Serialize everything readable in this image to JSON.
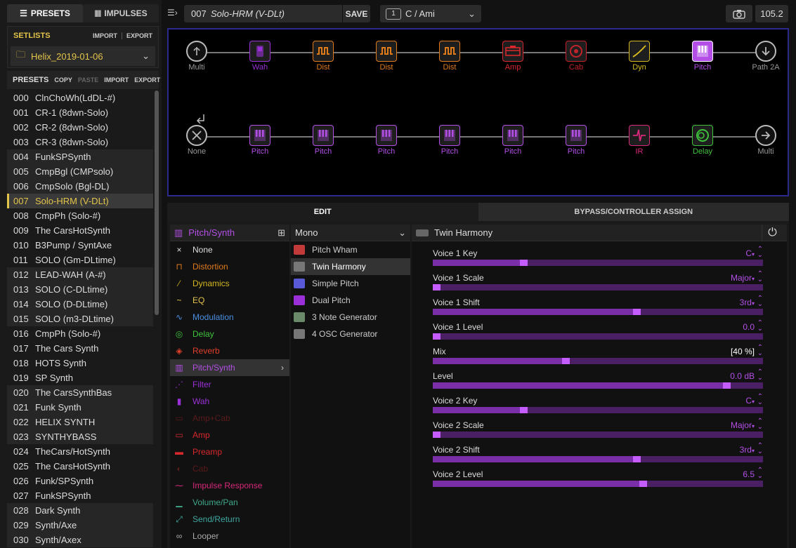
{
  "tabs": {
    "presets": "PRESETS",
    "impulses": "IMPULSES"
  },
  "setlists": {
    "title": "SETLISTS",
    "import": "IMPORT",
    "export": "EXPORT",
    "selected": "Helix_2019-01-06"
  },
  "presets_header": {
    "title": "PRESETS",
    "copy": "COPY",
    "paste": "PASTE",
    "import": "IMPORT",
    "export": "EXPORT"
  },
  "presets": [
    {
      "num": "000",
      "name": "ClnChoWh(LdDL-#)"
    },
    {
      "num": "001",
      "name": "CR-1 (8dwn-Solo)"
    },
    {
      "num": "002",
      "name": "CR-2 (8dwn-Solo)"
    },
    {
      "num": "003",
      "name": "CR-3 (8dwn-Solo)"
    },
    {
      "num": "004",
      "name": "FunkSPSynth"
    },
    {
      "num": "005",
      "name": "CmpBgl (CMPsolo)"
    },
    {
      "num": "006",
      "name": "CmpSolo (Bgl-DL)"
    },
    {
      "num": "007",
      "name": "Solo-HRM (V-DLt)"
    },
    {
      "num": "008",
      "name": "CmpPh (Solo-#)"
    },
    {
      "num": "009",
      "name": "The CarsHotSynth"
    },
    {
      "num": "010",
      "name": "B3Pump / SyntAxe"
    },
    {
      "num": "011",
      "name": "SOLO (Gm-DLtime)"
    },
    {
      "num": "012",
      "name": "LEAD-WAH (A-#)"
    },
    {
      "num": "013",
      "name": "SOLO (C-DLtime)"
    },
    {
      "num": "014",
      "name": "SOLO (D-DLtime)"
    },
    {
      "num": "015",
      "name": "SOLO (m3-DLtime)"
    },
    {
      "num": "016",
      "name": "CmpPh (Solo-#)"
    },
    {
      "num": "017",
      "name": "The Cars Synth"
    },
    {
      "num": "018",
      "name": "HOTS Synth"
    },
    {
      "num": "019",
      "name": "SP Synth"
    },
    {
      "num": "020",
      "name": "The CarsSynthBas"
    },
    {
      "num": "021",
      "name": "Funk Synth"
    },
    {
      "num": "022",
      "name": "HELIX SYNTH"
    },
    {
      "num": "023",
      "name": "SYNTHYBASS"
    },
    {
      "num": "024",
      "name": "TheCars/HotSynth"
    },
    {
      "num": "025",
      "name": "The CarsHotSynth"
    },
    {
      "num": "026",
      "name": "Funk/SPSynth"
    },
    {
      "num": "027",
      "name": "FunkSPSynth"
    },
    {
      "num": "028",
      "name": "Dark Synth"
    },
    {
      "num": "029",
      "name": "Synth/Axe"
    },
    {
      "num": "030",
      "name": "Synth/Axex"
    }
  ],
  "current_preset": {
    "num": "007",
    "name": "Solo-HRM (V-DLt)",
    "save": "SAVE"
  },
  "snapshot": {
    "badge": "1",
    "label": "C / Ami"
  },
  "tempo": "105.2",
  "flow_row1": [
    {
      "label": "Multi",
      "color": "#999999"
    },
    {
      "label": "Wah",
      "color": "#9b30d9"
    },
    {
      "label": "Dist",
      "color": "#e07b1a"
    },
    {
      "label": "Dist",
      "color": "#e07b1a"
    },
    {
      "label": "Dist",
      "color": "#e07b1a"
    },
    {
      "label": "Amp",
      "color": "#d8282d"
    },
    {
      "label": "Cab",
      "color": "#c2232a"
    },
    {
      "label": "Dyn",
      "color": "#d4b81e"
    },
    {
      "label": "Pitch",
      "color": "#b34fe6"
    },
    {
      "label": "Path 2A",
      "color": "#999999"
    }
  ],
  "flow_row2": [
    {
      "label": "None",
      "color": "#999999"
    },
    {
      "label": "Pitch",
      "color": "#b34fe6"
    },
    {
      "label": "Pitch",
      "color": "#b34fe6"
    },
    {
      "label": "Pitch",
      "color": "#b34fe6"
    },
    {
      "label": "Pitch",
      "color": "#b34fe6"
    },
    {
      "label": "Pitch",
      "color": "#b34fe6"
    },
    {
      "label": "Pitch",
      "color": "#b34fe6"
    },
    {
      "label": "IR",
      "color": "#d8287a"
    },
    {
      "label": "Delay",
      "color": "#3fc23b"
    },
    {
      "label": "Multi",
      "color": "#999999"
    }
  ],
  "edit_tabs": {
    "edit": "EDIT",
    "bypass": "BYPASS/CONTROLLER ASSIGN"
  },
  "category_header": "Pitch/Synth",
  "categories": [
    {
      "label": "None",
      "color": "#dddddd",
      "icon": "×"
    },
    {
      "label": "Distortion",
      "color": "#e07b1a",
      "icon": "⊓"
    },
    {
      "label": "Dynamics",
      "color": "#d4b81e",
      "icon": "⁄"
    },
    {
      "label": "EQ",
      "color": "#e3c44a",
      "icon": "~"
    },
    {
      "label": "Modulation",
      "color": "#4a8fe0",
      "icon": "∿"
    },
    {
      "label": "Delay",
      "color": "#3fc23b",
      "icon": "◎"
    },
    {
      "label": "Reverb",
      "color": "#e0402a",
      "icon": "◈"
    },
    {
      "label": "Pitch/Synth",
      "color": "#b34fe6",
      "icon": "▥"
    },
    {
      "label": "Filter",
      "color": "#9b30d9",
      "icon": "⋰"
    },
    {
      "label": "Wah",
      "color": "#9b30d9",
      "icon": "▮"
    },
    {
      "label": "Amp+Cab",
      "color": "#5a1a1a",
      "icon": "▭"
    },
    {
      "label": "Amp",
      "color": "#d8282d",
      "icon": "▭"
    },
    {
      "label": "Preamp",
      "color": "#d8282d",
      "icon": "▬"
    },
    {
      "label": "Cab",
      "color": "#5a1a1a",
      "icon": "◐"
    },
    {
      "label": "Impulse Response",
      "color": "#d8287a",
      "icon": "⁓"
    },
    {
      "label": "Volume/Pan",
      "color": "#3fa88a",
      "icon": "▁"
    },
    {
      "label": "Send/Return",
      "color": "#3fa8a0",
      "icon": "⤢"
    },
    {
      "label": "Looper",
      "color": "#aaaaaa",
      "icon": "∞"
    }
  ],
  "model_header": "Mono",
  "models": [
    {
      "label": "Pitch Wham",
      "color": "#c23a3a"
    },
    {
      "label": "Twin Harmony",
      "color": "#777777"
    },
    {
      "label": "Simple Pitch",
      "color": "#5a5ad8"
    },
    {
      "label": "Dual Pitch",
      "color": "#9b30d9"
    },
    {
      "label": "3 Note Generator",
      "color": "#6a8a6a"
    },
    {
      "label": "4 OSC Generator",
      "color": "#777777"
    }
  ],
  "block_title": "Twin Harmony",
  "params": [
    {
      "name": "Voice 1 Key",
      "value": "C",
      "level": 0.27,
      "dropdown": true
    },
    {
      "name": "Voice 1 Scale",
      "value": "Major",
      "level": 0.0,
      "dropdown": true
    },
    {
      "name": "Voice 1 Shift",
      "value": "3rd",
      "level": 0.62,
      "dropdown": true
    },
    {
      "name": "Voice 1 Level",
      "value": "0.0",
      "level": 0.0,
      "dropdown": false
    },
    {
      "name": "Mix",
      "value": "[40 %]",
      "level": 0.4,
      "dropdown": false,
      "white": true
    },
    {
      "name": "Level",
      "value": "0.0 dB",
      "level": 0.9,
      "dropdown": false
    },
    {
      "name": "Voice 2 Key",
      "value": "C",
      "level": 0.27,
      "dropdown": true
    },
    {
      "name": "Voice 2 Scale",
      "value": "Major",
      "level": 0.0,
      "dropdown": true
    },
    {
      "name": "Voice 2 Shift",
      "value": "3rd",
      "level": 0.62,
      "dropdown": true
    },
    {
      "name": "Voice 2 Level",
      "value": "6.5",
      "level": 0.64,
      "dropdown": false
    }
  ]
}
